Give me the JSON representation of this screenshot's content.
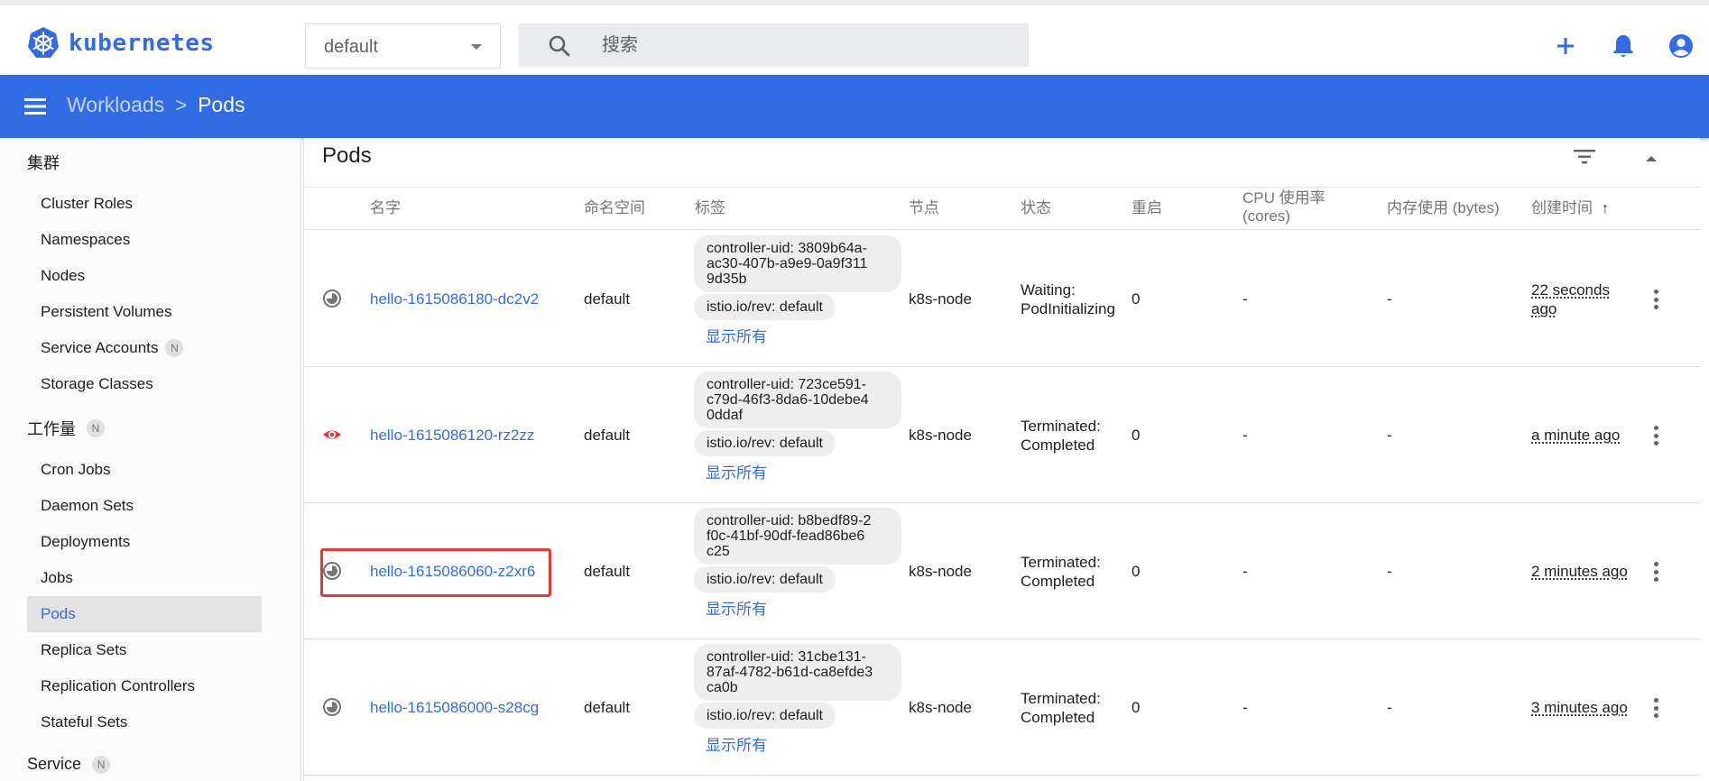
{
  "header": {
    "brand": "kubernetes",
    "namespace_value": "default",
    "search_placeholder": "搜索"
  },
  "breadcrumb": {
    "parent": "Workloads",
    "separator": ">",
    "current": "Pods"
  },
  "sidebar": {
    "cluster_label": "集群",
    "cluster_items": [
      "Cluster Roles",
      "Namespaces",
      "Nodes",
      "Persistent Volumes",
      "Service Accounts",
      "Storage Classes"
    ],
    "service_accounts_badge": "N",
    "workloads_label": "工作量",
    "workloads_badge": "N",
    "workload_items": [
      "Cron Jobs",
      "Daemon Sets",
      "Deployments",
      "Jobs",
      "Pods",
      "Replica Sets",
      "Replication Controllers",
      "Stateful Sets"
    ],
    "active_item": "Pods",
    "service_label": "Service",
    "service_badge": "N"
  },
  "card": {
    "title": "Pods",
    "columns": {
      "name": "名字",
      "namespace": "命名空间",
      "labels": "标签",
      "node": "节点",
      "status": "状态",
      "restarts": "重启",
      "cpu_line1": "CPU 使用率",
      "cpu_line2": "(cores)",
      "memory": "内存使用 (bytes)",
      "created": "创建时间",
      "sort_arrow": "↑"
    },
    "rows": [
      {
        "status_icon": "pending-icon",
        "name": "hello-1615086180-dc2v2",
        "namespace": "default",
        "uid_line1": "controller-uid: 3809b64a-",
        "uid_line2": "ac30-407b-a9e9-0a9f311",
        "uid_line3": "9d35b",
        "rev_label": "istio.io/rev: default",
        "show_all": "显示所有",
        "node": "k8s-node",
        "status_line1": "Waiting:",
        "status_line2": "PodInitializing",
        "restarts": "0",
        "cpu": "-",
        "memory": "-",
        "age_line1": "22 seconds",
        "age_line2": "ago"
      },
      {
        "status_icon": "eye-icon",
        "name": "hello-1615086120-rz2zz",
        "namespace": "default",
        "uid_line1": "controller-uid: 723ce591-",
        "uid_line2": "c79d-46f3-8da6-10debe4",
        "uid_line3": "0ddaf",
        "rev_label": "istio.io/rev: default",
        "show_all": "显示所有",
        "node": "k8s-node",
        "status_line1": "Terminated:",
        "status_line2": "Completed",
        "restarts": "0",
        "cpu": "-",
        "memory": "-",
        "age_line1": "a minute ago",
        "age_line2": ""
      },
      {
        "status_icon": "pending-icon",
        "name": "hello-1615086060-z2xr6",
        "namespace": "default",
        "uid_line1": "controller-uid: b8bedf89-2",
        "uid_line2": "f0c-41bf-90df-fead86be6",
        "uid_line3": "c25",
        "rev_label": "istio.io/rev: default",
        "show_all": "显示所有",
        "node": "k8s-node",
        "status_line1": "Terminated:",
        "status_line2": "Completed",
        "restarts": "0",
        "cpu": "-",
        "memory": "-",
        "age_line1": "2 minutes ago",
        "age_line2": ""
      },
      {
        "status_icon": "pending-icon",
        "name": "hello-1615086000-s28cg",
        "namespace": "default",
        "uid_line1": "controller-uid: 31cbe131-",
        "uid_line2": "87af-4782-b61d-ca8efde3",
        "uid_line3": "ca0b",
        "rev_label": "istio.io/rev: default",
        "show_all": "显示所有",
        "node": "k8s-node",
        "status_line1": "Terminated:",
        "status_line2": "Completed",
        "restarts": "0",
        "cpu": "-",
        "memory": "-",
        "age_line1": "3 minutes ago",
        "age_line2": ""
      }
    ]
  },
  "colors": {
    "brand_blue": "#326ce5",
    "error_red": "#e53935",
    "highlight_box": "#e53935"
  }
}
